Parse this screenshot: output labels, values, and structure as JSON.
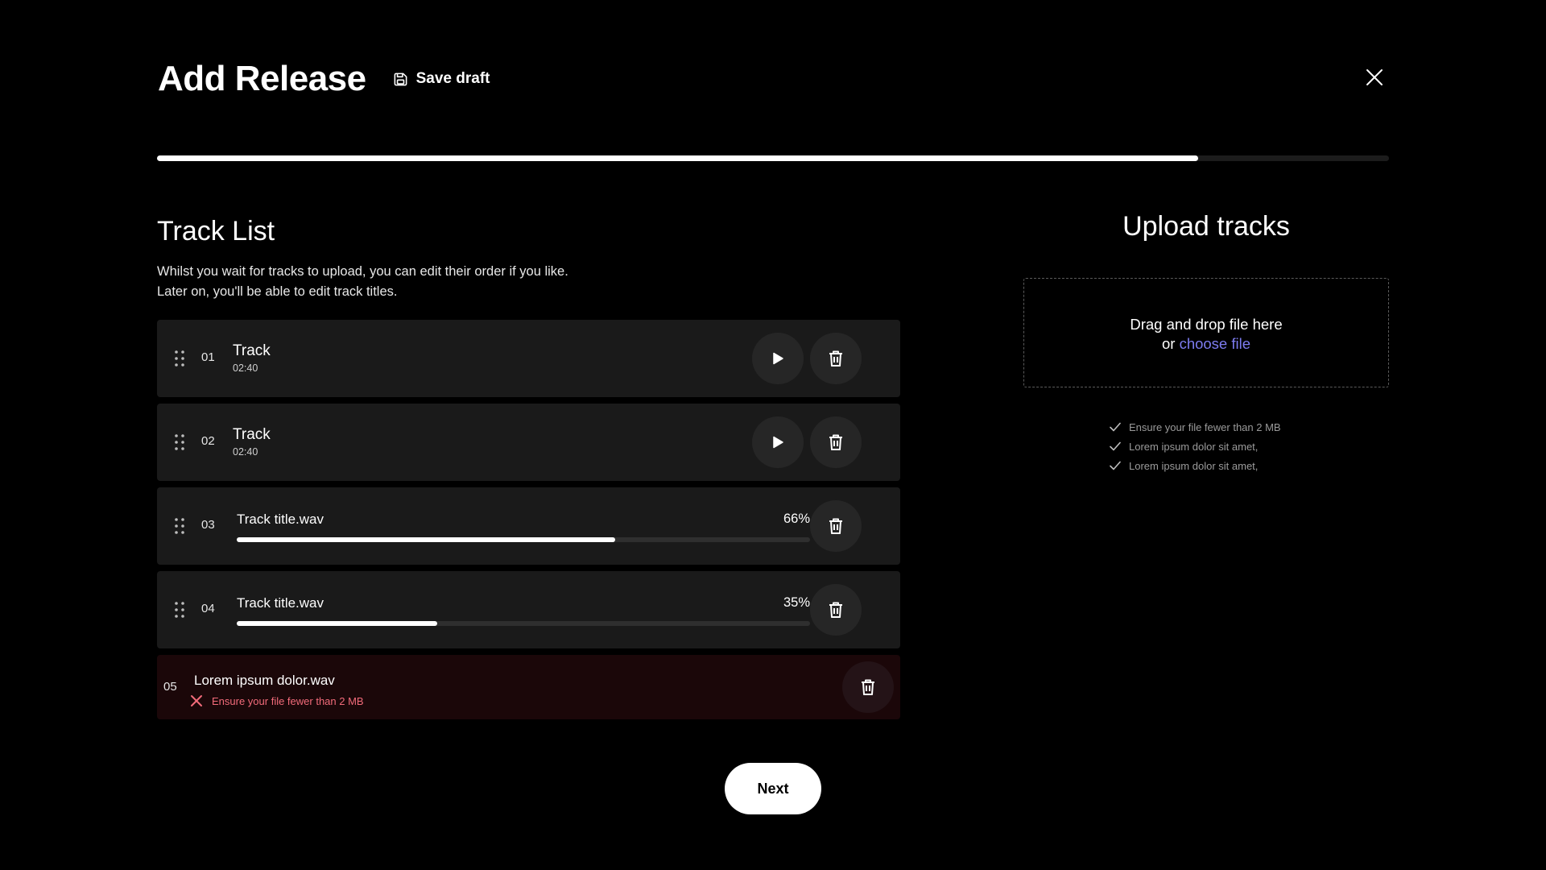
{
  "header": {
    "title": "Add Release",
    "save_draft_label": "Save draft",
    "progress_fraction": 0.845
  },
  "track_list": {
    "title": "Track List",
    "description_line1": "Whilst you wait for tracks to upload, you can edit their order if you like.",
    "description_line2": "Later on, you'll be able to edit track titles.",
    "tracks": [
      {
        "number": "01",
        "title": "Track",
        "duration": "02:40",
        "state": "uploaded"
      },
      {
        "number": "02",
        "title": "Track",
        "duration": "02:40",
        "state": "uploaded"
      },
      {
        "number": "03",
        "file_name": "Track title.wav",
        "progress_label": "66%",
        "progress": 0.66,
        "state": "uploading"
      },
      {
        "number": "04",
        "file_name": "Track title.wav",
        "progress_label": "35%",
        "progress": 0.35,
        "state": "uploading"
      },
      {
        "number": "05",
        "file_name": "Lorem ipsum dolor.wav",
        "error_message": "Ensure your file fewer than 2 MB",
        "state": "error"
      }
    ]
  },
  "upload": {
    "title": "Upload tracks",
    "drop_text": "Drag and drop file here",
    "or_text": "or",
    "choose_file_label": "choose file",
    "requirements": [
      "Ensure your file fewer than 2 MB",
      "Lorem ipsum dolor sit amet,",
      "Lorem ipsum dolor sit amet,"
    ]
  },
  "actions": {
    "next_label": "Next"
  },
  "colors": {
    "background": "#000000",
    "row": "#1a1a1a",
    "error_row": "#1b0709",
    "link": "#7d7cf0",
    "error_text": "#f26b7a"
  },
  "icons": [
    "save-icon",
    "close-icon",
    "drag-handle-icon",
    "play-icon",
    "trash-icon",
    "error-x-icon",
    "check-icon"
  ]
}
